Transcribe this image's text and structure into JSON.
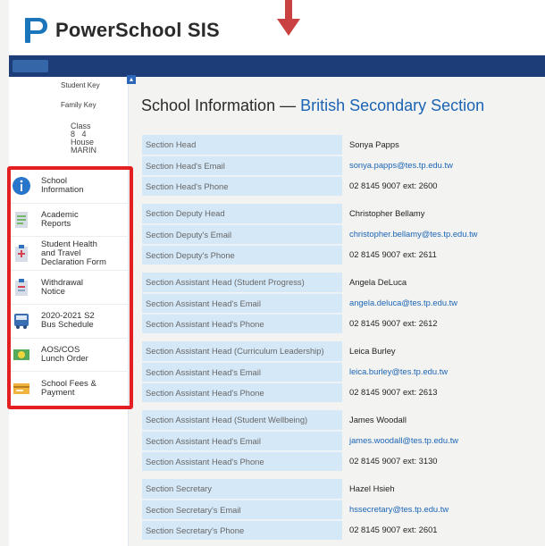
{
  "app": {
    "brand": "PowerSchool SIS"
  },
  "student_keys": {
    "student_key": "Student Key",
    "family_key": "Family Key",
    "class_label": "Class",
    "class_value_1": "8",
    "class_value_2": "4",
    "house_label": "House",
    "house_value": "MARIN"
  },
  "sidebar": {
    "items": [
      {
        "label": "School\nInformation"
      },
      {
        "label": "Academic\nReports"
      },
      {
        "label": "Student Health\nand Travel\nDeclaration Form"
      },
      {
        "label": "Withdrawal\nNotice"
      },
      {
        "label": "2020-2021 S2\nBus Schedule"
      },
      {
        "label": "AOS/COS\nLunch Order"
      },
      {
        "label": "School Fees &\nPayment"
      }
    ]
  },
  "page": {
    "title_prefix": "School Information — ",
    "title_section": "British Secondary Section"
  },
  "info": {
    "groups": [
      {
        "rows": [
          {
            "label": "Section Head",
            "value": "Sonya Papps",
            "type": "text"
          },
          {
            "label": "Section Head's Email",
            "value": "sonya.papps@tes.tp.edu.tw",
            "type": "email"
          },
          {
            "label": "Section Head's Phone",
            "value": "02 8145 9007 ext: 2600",
            "type": "text"
          }
        ]
      },
      {
        "rows": [
          {
            "label": "Section Deputy Head",
            "value": "Christopher Bellamy",
            "type": "text"
          },
          {
            "label": "Section Deputy's Email",
            "value": "christopher.bellamy@tes.tp.edu.tw",
            "type": "email"
          },
          {
            "label": "Section Deputy's Phone",
            "value": "02 8145 9007 ext: 2611",
            "type": "text"
          }
        ]
      },
      {
        "rows": [
          {
            "label": "Section Assistant Head (Student Progress)",
            "value": "Angela DeLuca",
            "type": "text"
          },
          {
            "label": "Section Assistant Head's Email",
            "value": "angela.deluca@tes.tp.edu.tw",
            "type": "email"
          },
          {
            "label": "Section Assistant Head's Phone",
            "value": "02 8145 9007 ext: 2612",
            "type": "text"
          }
        ]
      },
      {
        "rows": [
          {
            "label": "Section Assistant Head (Curriculum Leadership)",
            "value": "Leica Burley",
            "type": "text"
          },
          {
            "label": "Section Assistant Head's Email",
            "value": "leica.burley@tes.tp.edu.tw",
            "type": "email"
          },
          {
            "label": "Section Assistant Head's Phone",
            "value": "02 8145 9007 ext: 2613",
            "type": "text"
          }
        ]
      },
      {
        "rows": [
          {
            "label": "Section Assistant Head (Student Wellbeing)",
            "value": "James Woodall",
            "type": "text"
          },
          {
            "label": "Section Assistant Head's Email",
            "value": "james.woodall@tes.tp.edu.tw",
            "type": "email"
          },
          {
            "label": "Section Assistant Head's Phone",
            "value": "02 8145 9007 ext: 3130",
            "type": "text"
          }
        ]
      },
      {
        "rows": [
          {
            "label": "Section Secretary",
            "value": "Hazel Hsieh",
            "type": "text"
          },
          {
            "label": "Section Secretary's Email",
            "value": "hssecretary@tes.tp.edu.tw",
            "type": "email"
          },
          {
            "label": "Section Secretary's Phone",
            "value": "02 8145 9007 ext: 2601",
            "type": "text"
          }
        ]
      }
    ]
  },
  "colors": {
    "header_blue": "#1c3d78",
    "link_blue": "#1b63b3",
    "label_bg": "#d5e8f7",
    "highlight_red": "#e41f22"
  },
  "icons": {
    "sidebar": [
      "info-icon",
      "document-icon",
      "health-form-icon",
      "withdrawal-form-icon",
      "bus-icon",
      "lunch-icon",
      "payment-icon"
    ],
    "topbar": "red-down-arrow"
  }
}
